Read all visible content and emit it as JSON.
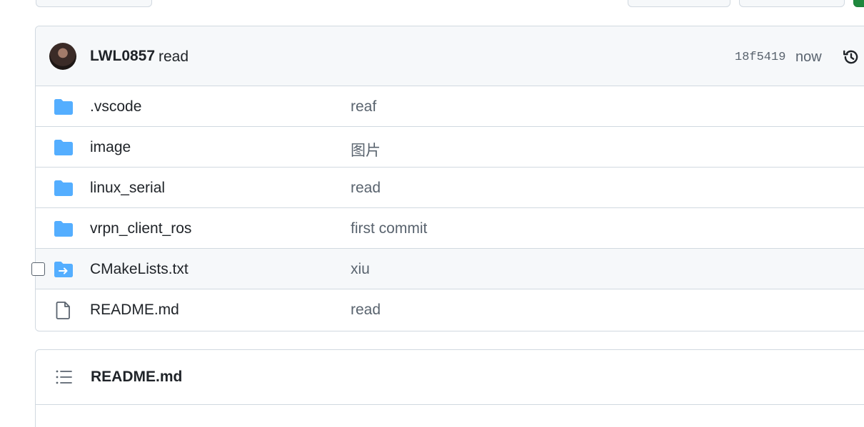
{
  "commit": {
    "author": "LWL0857",
    "message": "read",
    "sha": "18f5419",
    "time": "now"
  },
  "files": [
    {
      "name": ".vscode",
      "message": "reaf",
      "icon": "folder-icon"
    },
    {
      "name": "image",
      "message": "图片",
      "icon": "folder-icon"
    },
    {
      "name": "linux_serial",
      "message": "read",
      "icon": "folder-icon"
    },
    {
      "name": "vrpn_client_ros",
      "message": "first commit",
      "icon": "folder-icon"
    },
    {
      "name": "CMakeLists.txt",
      "message": "xiu",
      "icon": "symlink-folder-icon"
    },
    {
      "name": "README.md",
      "message": "read",
      "icon": "file-icon"
    }
  ],
  "readme": {
    "title": "README.md"
  },
  "colors": {
    "folder": "#54aeff",
    "border": "#d1d9e0",
    "muted_text": "#59636e",
    "header_bg": "#f6f8fa",
    "primary_button": "#1f883d"
  }
}
